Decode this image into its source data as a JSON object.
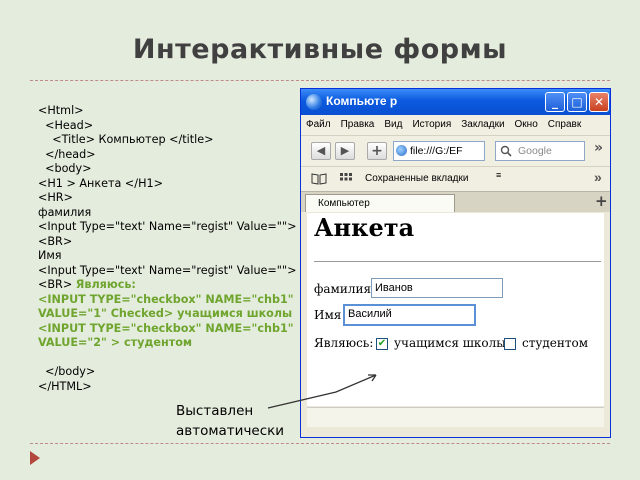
{
  "slide": {
    "title": "Интерактивные формы",
    "code_lines": [
      {
        "text": "<Html>",
        "hl": false
      },
      {
        "text": "  <Head>",
        "hl": false
      },
      {
        "text": "    <Title> Компьютер </title>",
        "hl": false
      },
      {
        "text": "  </head>",
        "hl": false
      },
      {
        "text": "  <body>",
        "hl": false
      },
      {
        "text": "<H1 > Анкета </H1>",
        "hl": false
      },
      {
        "text": "<HR>",
        "hl": false
      },
      {
        "text": "фамилия",
        "hl": false
      },
      {
        "text": "<Input Type=\"text' Name=\"regist\" Value=\"\">",
        "hl": false
      },
      {
        "text": "<BR>",
        "hl": false
      },
      {
        "text": "Имя",
        "hl": false
      },
      {
        "text": "<Input Type=\"text' Name=\"regist\" Value=\"\">",
        "hl": false
      },
      {
        "text": "<BR> ",
        "hl": false,
        "green_tail": "Являюсь:"
      },
      {
        "text": "<INPUT TYPE=\"checkbox\" NAME=\"chb1\"",
        "hl": true
      },
      {
        "text": "VALUE=\"1\" Checked> учащимся школы",
        "hl": true
      },
      {
        "text": "<INPUT TYPE=\"checkbox\" NAME=\"chb1\"",
        "hl": true
      },
      {
        "text": "VALUE=\"2\" > студентом",
        "hl": true
      },
      {
        "text": " ",
        "hl": false
      },
      {
        "text": "  </body>",
        "hl": false
      },
      {
        "text": "</HTML>",
        "hl": false
      }
    ],
    "annotation": "Выставлен\nавтоматически"
  },
  "browser": {
    "title": "Компьюте р",
    "controls": {
      "minimize": "_",
      "maximize": "□",
      "close": "✕"
    },
    "menu": [
      "Файл",
      "Правка",
      "Вид",
      "История",
      "Закладки",
      "Окно",
      "Справк"
    ],
    "nav": {
      "back": "◀",
      "forward": "▶",
      "new_tab": "+",
      "url": "file:///G:/EF",
      "search_placeholder": "Google",
      "more": "»"
    },
    "bookmarks": {
      "label": "Сохраненные вкладки",
      "more": "»"
    },
    "tab": {
      "label": "Компьютер",
      "new": "+"
    },
    "page": {
      "heading": "Анкета",
      "surname_label": "фамилия",
      "surname_value": "Иванов",
      "name_label": "Имя",
      "name_value": "Василий",
      "role_label": "Являюсь:",
      "cb1_label": "учащимся школы",
      "cb1_checked": true,
      "cb2_label": "студентом",
      "cb2_checked": false
    }
  },
  "colors": {
    "background": "#e4ecdd",
    "highlight_code": "#6fa52e",
    "titlebar": "#0b5ae0",
    "accent_triangle": "#b3473e"
  },
  "icons": [
    "browser-globe-icon",
    "bookmark-book-icon",
    "grid-icon",
    "search-magnifier-icon",
    "nav-triangle-icon"
  ]
}
